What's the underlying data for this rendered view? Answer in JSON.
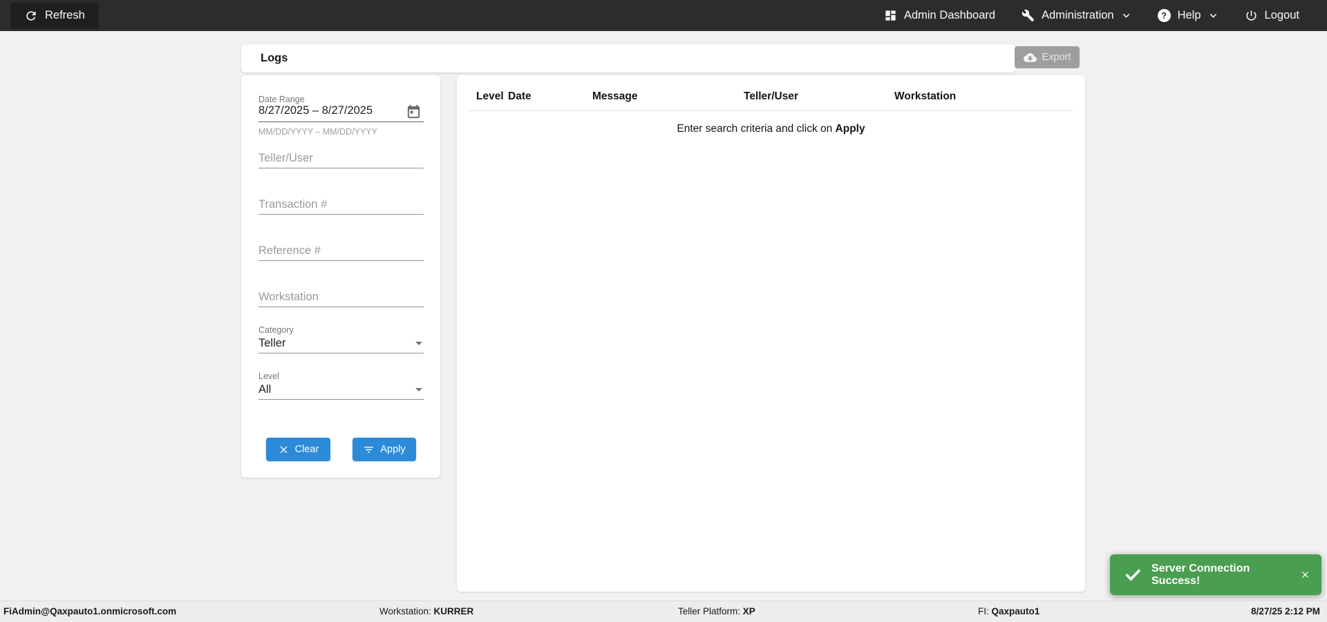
{
  "topbar": {
    "refresh": "Refresh",
    "admin_dashboard": "Admin Dashboard",
    "administration": "Administration",
    "help": "Help",
    "logout": "Logout"
  },
  "header": {
    "title": "Logs",
    "export_label": "Export"
  },
  "filters": {
    "date_range": {
      "label": "Date Range",
      "value": "8/27/2025 – 8/27/2025",
      "hint": "MM/DD/YYYY – MM/DD/YYYY"
    },
    "teller_user_placeholder": "Teller/User",
    "transaction_placeholder": "Transaction #",
    "reference_placeholder": "Reference #",
    "workstation_placeholder": "Workstation",
    "category": {
      "label": "Category",
      "value": "Teller"
    },
    "level": {
      "label": "Level",
      "value": "All"
    },
    "clear_label": "Clear",
    "apply_label": "Apply"
  },
  "table": {
    "columns": [
      "Level",
      "Date",
      "Message",
      "Teller/User",
      "Workstation"
    ],
    "rows": [],
    "empty_message_prefix": "Enter search criteria and click on ",
    "empty_message_action": "Apply"
  },
  "toast": {
    "message": "Server Connection Success!"
  },
  "statusbar": {
    "user": "FiAdmin@Qaxpauto1.onmicrosoft.com",
    "workstation_label": "Workstation: ",
    "workstation_value": "KURRER",
    "platform_label": "Teller Platform: ",
    "platform_value": "XP",
    "fi_label": "FI: ",
    "fi_value": "Qaxpauto1",
    "datetime": "8/27/25 2:12 PM"
  },
  "colors": {
    "topbar_bg": "#2c2c2c",
    "accent_blue": "#2b8bd9",
    "toast_green": "#4a9e50",
    "export_gray": "#9e9e9e",
    "page_bg": "#f1f1f1"
  }
}
